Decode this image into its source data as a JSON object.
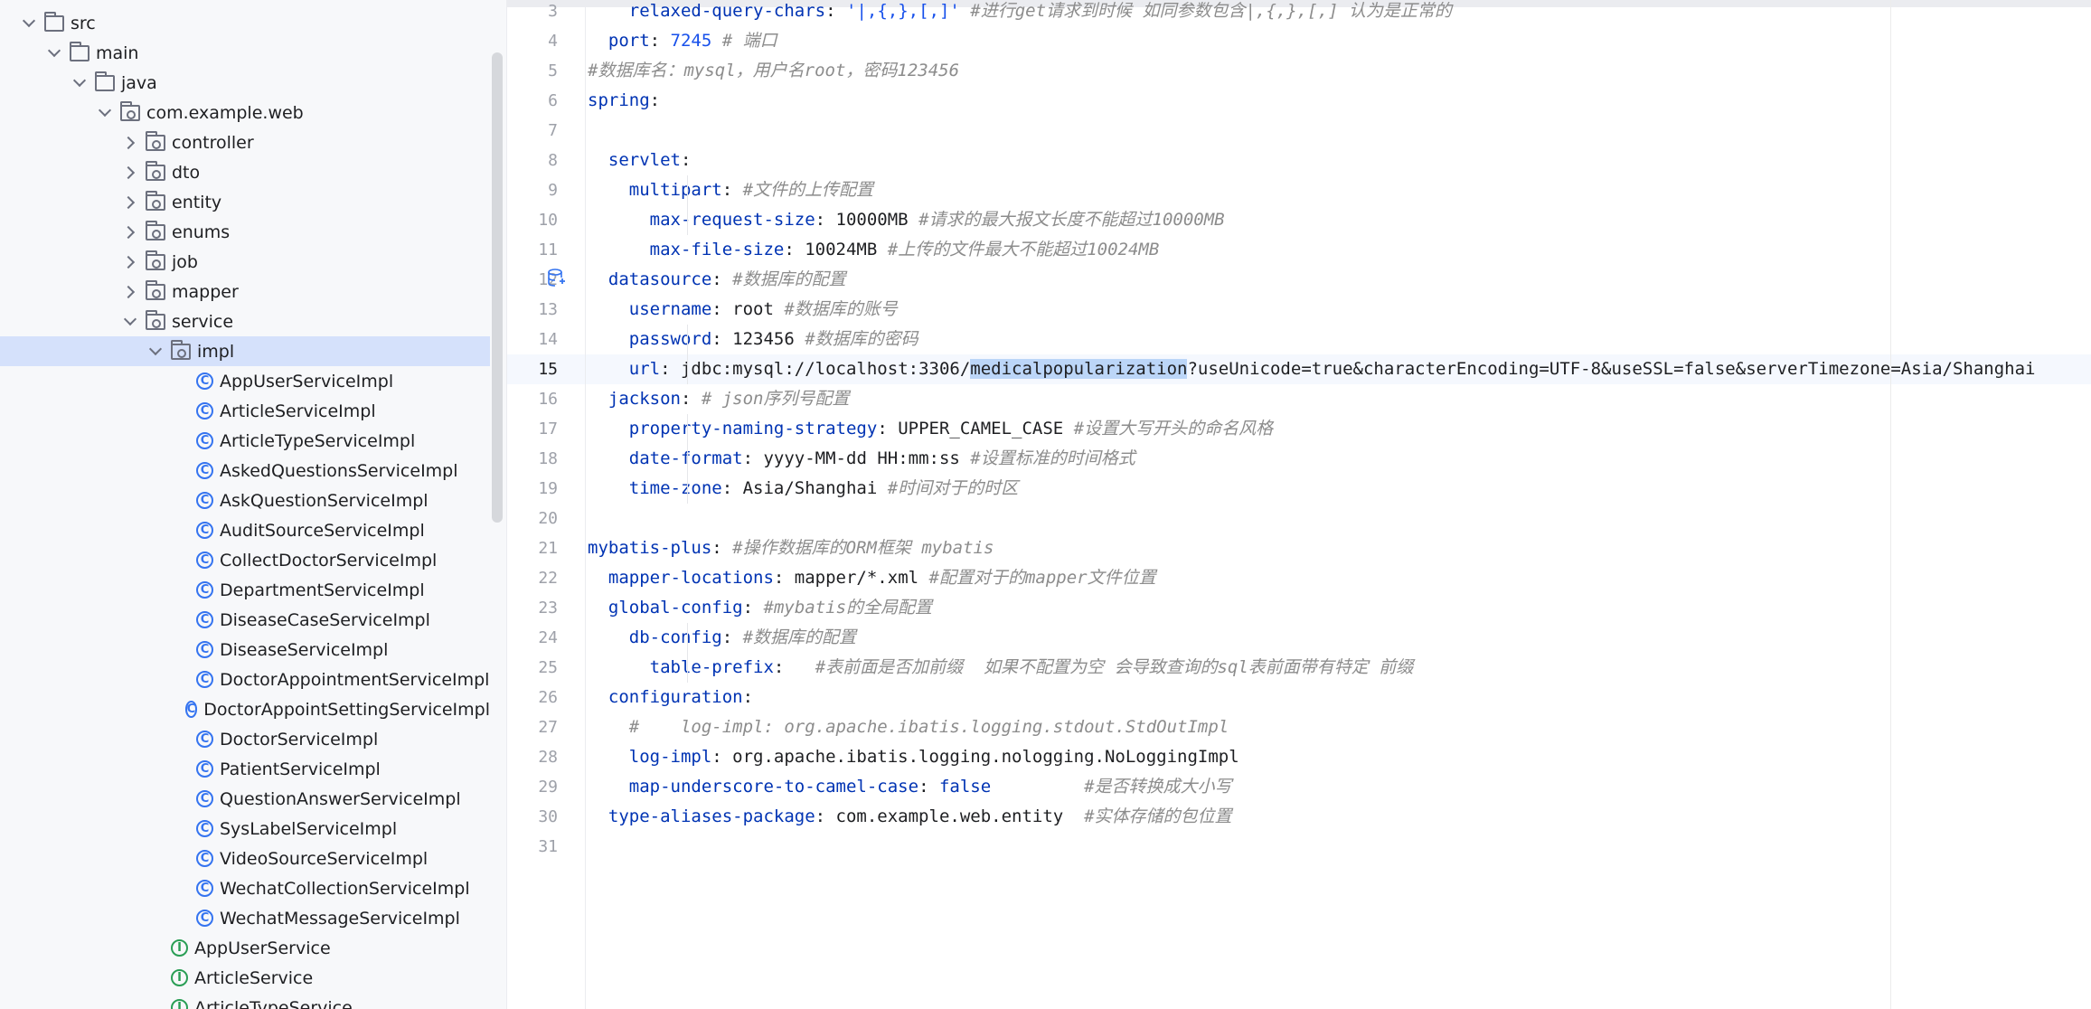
{
  "project_tree": {
    "nodes": [
      {
        "label": "src",
        "depth": 0,
        "kind": "folder",
        "chevron": "down"
      },
      {
        "label": "main",
        "depth": 1,
        "kind": "folder",
        "chevron": "down"
      },
      {
        "label": "java",
        "depth": 2,
        "kind": "folder",
        "chevron": "down"
      },
      {
        "label": "com.example.web",
        "depth": 3,
        "kind": "package",
        "chevron": "down"
      },
      {
        "label": "controller",
        "depth": 4,
        "kind": "package",
        "chevron": "right"
      },
      {
        "label": "dto",
        "depth": 4,
        "kind": "package",
        "chevron": "right"
      },
      {
        "label": "entity",
        "depth": 4,
        "kind": "package",
        "chevron": "right"
      },
      {
        "label": "enums",
        "depth": 4,
        "kind": "package",
        "chevron": "right"
      },
      {
        "label": "job",
        "depth": 4,
        "kind": "package",
        "chevron": "right"
      },
      {
        "label": "mapper",
        "depth": 4,
        "kind": "package",
        "chevron": "right"
      },
      {
        "label": "service",
        "depth": 4,
        "kind": "package",
        "chevron": "down"
      },
      {
        "label": "impl",
        "depth": 5,
        "kind": "package",
        "chevron": "down",
        "selected": true
      },
      {
        "label": "AppUserServiceImpl",
        "depth": 6,
        "kind": "class"
      },
      {
        "label": "ArticleServiceImpl",
        "depth": 6,
        "kind": "class"
      },
      {
        "label": "ArticleTypeServiceImpl",
        "depth": 6,
        "kind": "class"
      },
      {
        "label": "AskedQuestionsServiceImpl",
        "depth": 6,
        "kind": "class"
      },
      {
        "label": "AskQuestionServiceImpl",
        "depth": 6,
        "kind": "class"
      },
      {
        "label": "AuditSourceServiceImpl",
        "depth": 6,
        "kind": "class"
      },
      {
        "label": "CollectDoctorServiceImpl",
        "depth": 6,
        "kind": "class"
      },
      {
        "label": "DepartmentServiceImpl",
        "depth": 6,
        "kind": "class"
      },
      {
        "label": "DiseaseCaseServiceImpl",
        "depth": 6,
        "kind": "class"
      },
      {
        "label": "DiseaseServiceImpl",
        "depth": 6,
        "kind": "class"
      },
      {
        "label": "DoctorAppointmentServiceImpl",
        "depth": 6,
        "kind": "class"
      },
      {
        "label": "DoctorAppointSettingServiceImpl",
        "depth": 6,
        "kind": "class"
      },
      {
        "label": "DoctorServiceImpl",
        "depth": 6,
        "kind": "class"
      },
      {
        "label": "PatientServiceImpl",
        "depth": 6,
        "kind": "class"
      },
      {
        "label": "QuestionAnswerServiceImpl",
        "depth": 6,
        "kind": "class"
      },
      {
        "label": "SysLabelServiceImpl",
        "depth": 6,
        "kind": "class"
      },
      {
        "label": "VideoSourceServiceImpl",
        "depth": 6,
        "kind": "class"
      },
      {
        "label": "WechatCollectionServiceImpl",
        "depth": 6,
        "kind": "class"
      },
      {
        "label": "WechatMessageServiceImpl",
        "depth": 6,
        "kind": "class"
      },
      {
        "label": "AppUserService",
        "depth": 5,
        "kind": "interface"
      },
      {
        "label": "ArticleService",
        "depth": 5,
        "kind": "interface"
      },
      {
        "label": "ArticleTypeService",
        "depth": 5,
        "kind": "interface"
      }
    ]
  },
  "editor": {
    "current_line": 15,
    "lines": [
      {
        "num": "3",
        "tokens": [
          {
            "t": "    "
          },
          {
            "t": "relaxed-query-chars",
            "c": "k"
          },
          {
            "t": ": "
          },
          {
            "t": "'|,{,},[,]'",
            "c": "n"
          },
          {
            "t": " "
          },
          {
            "t": "#进行get请求到时候 如同参数包含|,{,},[,] 认为是正常的",
            "c": "c"
          }
        ]
      },
      {
        "num": "4",
        "tokens": [
          {
            "t": "  "
          },
          {
            "t": "port",
            "c": "k"
          },
          {
            "t": ": "
          },
          {
            "t": "7245",
            "c": "n"
          },
          {
            "t": " "
          },
          {
            "t": "# 端口",
            "c": "c"
          }
        ]
      },
      {
        "num": "5",
        "tokens": [
          {
            "t": "#数据库名：mysql，用户名root，密码123456",
            "c": "c"
          }
        ]
      },
      {
        "num": "6",
        "tokens": [
          {
            "t": "spring",
            "c": "k"
          },
          {
            "t": ":"
          }
        ]
      },
      {
        "num": "7",
        "tokens": []
      },
      {
        "num": "8",
        "tokens": [
          {
            "t": "  "
          },
          {
            "t": "servlet",
            "c": "k"
          },
          {
            "t": ":"
          }
        ]
      },
      {
        "num": "9",
        "tokens": [
          {
            "t": "    "
          },
          {
            "t": "multipart",
            "c": "k"
          },
          {
            "t": ": "
          },
          {
            "t": "#文件的上传配置",
            "c": "c"
          }
        ]
      },
      {
        "num": "10",
        "tokens": [
          {
            "t": "      "
          },
          {
            "t": "max-request-size",
            "c": "k"
          },
          {
            "t": ": 10000MB "
          },
          {
            "t": "#请求的最大报文长度不能超过10000MB",
            "c": "c"
          }
        ]
      },
      {
        "num": "11",
        "tokens": [
          {
            "t": "      "
          },
          {
            "t": "max-file-size",
            "c": "k"
          },
          {
            "t": ": 10024MB "
          },
          {
            "t": "#上传的文件最大不能超过10024MB",
            "c": "c"
          }
        ]
      },
      {
        "num": "12",
        "tokens": [
          {
            "t": "  "
          },
          {
            "t": "datasource",
            "c": "k"
          },
          {
            "t": ": "
          },
          {
            "t": "#数据库的配置",
            "c": "c"
          }
        ]
      },
      {
        "num": "13",
        "tokens": [
          {
            "t": "    "
          },
          {
            "t": "username",
            "c": "k"
          },
          {
            "t": ": root "
          },
          {
            "t": "#数据库的账号",
            "c": "c"
          }
        ]
      },
      {
        "num": "14",
        "tokens": [
          {
            "t": "    "
          },
          {
            "t": "password",
            "c": "k"
          },
          {
            "t": ": 123456 "
          },
          {
            "t": "#数据库的密码",
            "c": "c"
          }
        ]
      },
      {
        "num": "15",
        "tokens": [
          {
            "t": "    "
          },
          {
            "t": "url",
            "c": "k"
          },
          {
            "t": ": jdbc:mysql://localhost:3306/"
          },
          {
            "t": "medicalpopularization",
            "c": "sel"
          },
          {
            "t": "?useUnicode=true&characterEncoding=UTF-8&useSSL=false&serverTimezone=Asia/Shanghai"
          }
        ]
      },
      {
        "num": "16",
        "tokens": [
          {
            "t": "  "
          },
          {
            "t": "jackson",
            "c": "k"
          },
          {
            "t": ": "
          },
          {
            "t": "# json序列号配置",
            "c": "c"
          }
        ]
      },
      {
        "num": "17",
        "tokens": [
          {
            "t": "    "
          },
          {
            "t": "property-naming-strategy",
            "c": "k"
          },
          {
            "t": ": UPPER_CAMEL_CASE "
          },
          {
            "t": "#设置大写开头的命名风格",
            "c": "c"
          }
        ]
      },
      {
        "num": "18",
        "tokens": [
          {
            "t": "    "
          },
          {
            "t": "date-format",
            "c": "k"
          },
          {
            "t": ": yyyy-MM-dd HH:mm:ss "
          },
          {
            "t": "#设置标准的时间格式",
            "c": "c"
          }
        ]
      },
      {
        "num": "19",
        "tokens": [
          {
            "t": "    "
          },
          {
            "t": "time-zone",
            "c": "k"
          },
          {
            "t": ": Asia/Shanghai "
          },
          {
            "t": "#时间对于的时区",
            "c": "c"
          }
        ]
      },
      {
        "num": "20",
        "tokens": []
      },
      {
        "num": "21",
        "tokens": [
          {
            "t": "mybatis-plus",
            "c": "k"
          },
          {
            "t": ": "
          },
          {
            "t": "#操作数据库的ORM框架 mybatis",
            "c": "c"
          }
        ]
      },
      {
        "num": "22",
        "tokens": [
          {
            "t": "  "
          },
          {
            "t": "mapper-locations",
            "c": "k"
          },
          {
            "t": ": mapper/*.xml "
          },
          {
            "t": "#配置对于的mapper文件位置",
            "c": "c"
          }
        ]
      },
      {
        "num": "23",
        "tokens": [
          {
            "t": "  "
          },
          {
            "t": "global-config",
            "c": "k"
          },
          {
            "t": ": "
          },
          {
            "t": "#mybatis的全局配置",
            "c": "c"
          }
        ]
      },
      {
        "num": "24",
        "tokens": [
          {
            "t": "    "
          },
          {
            "t": "db-config",
            "c": "k"
          },
          {
            "t": ": "
          },
          {
            "t": "#数据库的配置",
            "c": "c"
          }
        ]
      },
      {
        "num": "25",
        "tokens": [
          {
            "t": "      "
          },
          {
            "t": "table-prefix",
            "c": "k"
          },
          {
            "t": ":   "
          },
          {
            "t": "#表前面是否加前缀  如果不配置为空 会导致查询的sql表前面带有特定 前缀",
            "c": "c"
          }
        ]
      },
      {
        "num": "26",
        "tokens": [
          {
            "t": "  "
          },
          {
            "t": "configuration",
            "c": "k"
          },
          {
            "t": ":"
          }
        ]
      },
      {
        "num": "27",
        "tokens": [
          {
            "t": "    "
          },
          {
            "t": "#    log-impl: org.apache.ibatis.logging.stdout.StdOutImpl",
            "c": "c"
          }
        ]
      },
      {
        "num": "28",
        "tokens": [
          {
            "t": "    "
          },
          {
            "t": "log-impl",
            "c": "k"
          },
          {
            "t": ": org.apache.ibatis.logging.nologging.NoLoggingImpl"
          }
        ]
      },
      {
        "num": "29",
        "tokens": [
          {
            "t": "    "
          },
          {
            "t": "map-underscore-to-camel-case",
            "c": "k"
          },
          {
            "t": ": "
          },
          {
            "t": "false",
            "c": "kw"
          },
          {
            "t": "         "
          },
          {
            "t": "#是否转换成大小写",
            "c": "c"
          }
        ]
      },
      {
        "num": "30",
        "tokens": [
          {
            "t": "  "
          },
          {
            "t": "type-aliases-package",
            "c": "k"
          },
          {
            "t": ": com.example.web.entity  "
          },
          {
            "t": "#实体存储的包位置",
            "c": "c"
          }
        ]
      },
      {
        "num": "31",
        "tokens": []
      }
    ]
  }
}
